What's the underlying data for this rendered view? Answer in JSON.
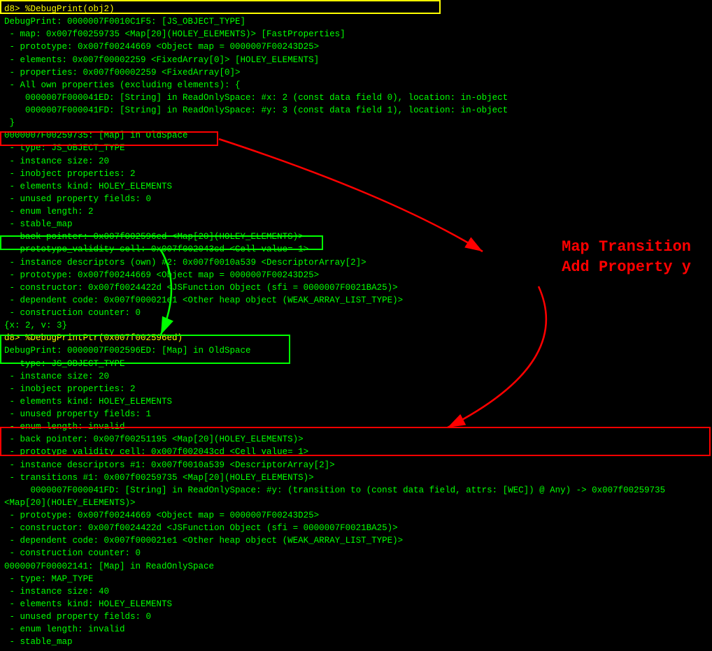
{
  "terminal": {
    "lines": [
      {
        "text": "d8> %DebugPrint(obj2)",
        "style": "yellow"
      },
      {
        "text": "DebugPrint: 0000007F0010C1F5: [JS_OBJECT_TYPE]",
        "style": "normal"
      },
      {
        "text": " - map: 0x007f00259735 <Map[20](HOLEY_ELEMENTS)> [FastProperties]",
        "style": "normal"
      },
      {
        "text": " - prototype: 0x007f00244669 <Object map = 0000007F00243D25>",
        "style": "normal"
      },
      {
        "text": " - elements: 0x007f00002259 <FixedArray[0]> [HOLEY_ELEMENTS]",
        "style": "normal"
      },
      {
        "text": " - properties: 0x007f00002259 <FixedArray[0]>",
        "style": "normal"
      },
      {
        "text": " - All own properties (excluding elements): {",
        "style": "normal"
      },
      {
        "text": "    0000007F000041ED: [String] in ReadOnlySpace: #x: 2 (const data field 0), location: in-object",
        "style": "normal"
      },
      {
        "text": "    0000007F000041FD: [String] in ReadOnlySpace: #y: 3 (const data field 1), location: in-object",
        "style": "normal"
      },
      {
        "text": " }",
        "style": "normal"
      },
      {
        "text": "0000007F00259735: [Map] in OldSpace",
        "style": "normal"
      },
      {
        "text": " - type: JS_OBJECT_TYPE",
        "style": "normal"
      },
      {
        "text": " - instance size: 20",
        "style": "normal"
      },
      {
        "text": " - inobject properties: 2",
        "style": "normal"
      },
      {
        "text": " - elements kind: HOLEY_ELEMENTS",
        "style": "normal"
      },
      {
        "text": " - unused property fields: 0",
        "style": "normal"
      },
      {
        "text": " - enum length: 2",
        "style": "normal"
      },
      {
        "text": " - stable_map",
        "style": "normal"
      },
      {
        "text": " - back pointer: 0x007f002596ed <Map[20](HOLEY_ELEMENTS)>",
        "style": "normal"
      },
      {
        "text": " - prototype_validity cell: 0x007f002043cd <Cell value= 1>",
        "style": "normal"
      },
      {
        "text": " - instance descriptors (own) #2: 0x007f0010a539 <DescriptorArray[2]>",
        "style": "normal"
      },
      {
        "text": " - prototype: 0x007f00244669 <Object map = 0000007F00243D25>",
        "style": "normal"
      },
      {
        "text": " - constructor: 0x007f0024422d <JSFunction Object (sfi = 0000007F0021BA25)>",
        "style": "normal"
      },
      {
        "text": " - dependent code: 0x007f000021e1 <Other heap object (WEAK_ARRAY_LIST_TYPE)>",
        "style": "normal"
      },
      {
        "text": " - construction counter: 0",
        "style": "normal"
      },
      {
        "text": "{x: 2, v: 3}",
        "style": "normal"
      },
      {
        "text": "d8> %DebugPrintPtr(0x007f002596ed)",
        "style": "yellow"
      },
      {
        "text": "DebugPrint: 0000007F002596ED: [Map] in OldSpace",
        "style": "normal"
      },
      {
        "text": " - type: JS_OBJECT_TYPE",
        "style": "normal"
      },
      {
        "text": " - instance size: 20",
        "style": "normal"
      },
      {
        "text": " - inobject properties: 2",
        "style": "normal"
      },
      {
        "text": " - elements kind: HOLEY_ELEMENTS",
        "style": "normal"
      },
      {
        "text": " - unused property fields: 1",
        "style": "normal"
      },
      {
        "text": " - enum length: invalid",
        "style": "normal"
      },
      {
        "text": " - back pointer: 0x007f00251195 <Map[20](HOLEY_ELEMENTS)>",
        "style": "normal"
      },
      {
        "text": " - prototype_validity cell: 0x007f002043cd <Cell value= 1>",
        "style": "normal"
      },
      {
        "text": " - instance descriptors #1: 0x007f0010a539 <DescriptorArray[2]>",
        "style": "normal"
      },
      {
        "text": " - transitions #1: 0x007f00259735 <Map[20](HOLEY_ELEMENTS)>",
        "style": "normal"
      },
      {
        "text": "     0000007F000041FD: [String] in ReadOnlySpace: #y: (transition to (const data field, attrs: [WEC]) @ Any) -> 0x007f00259735",
        "style": "normal"
      },
      {
        "text": "<Map[20](HOLEY_ELEMENTS)>",
        "style": "normal"
      },
      {
        "text": " - prototype: 0x007f00244669 <Object map = 0000007F00243D25>",
        "style": "normal"
      },
      {
        "text": " - constructor: 0x007f0024422d <JSFunction Object (sfi = 0000007F0021BA25)>",
        "style": "normal"
      },
      {
        "text": " - dependent code: 0x007f000021e1 <Other heap object (WEAK_ARRAY_LIST_TYPE)>",
        "style": "normal"
      },
      {
        "text": " - construction counter: 0",
        "style": "normal"
      },
      {
        "text": "0000007F00002141: [Map] in ReadOnlySpace",
        "style": "normal"
      },
      {
        "text": " - type: MAP_TYPE",
        "style": "normal"
      },
      {
        "text": " - instance size: 40",
        "style": "normal"
      },
      {
        "text": " - elements kind: HOLEY_ELEMENTS",
        "style": "normal"
      },
      {
        "text": " - unused property fields: 0",
        "style": "normal"
      },
      {
        "text": " - enum length: invalid",
        "style": "normal"
      },
      {
        "text": " - stable_map",
        "style": "normal"
      }
    ],
    "annotation": {
      "line1": "Map Transition",
      "line2": "Add Property y"
    }
  }
}
